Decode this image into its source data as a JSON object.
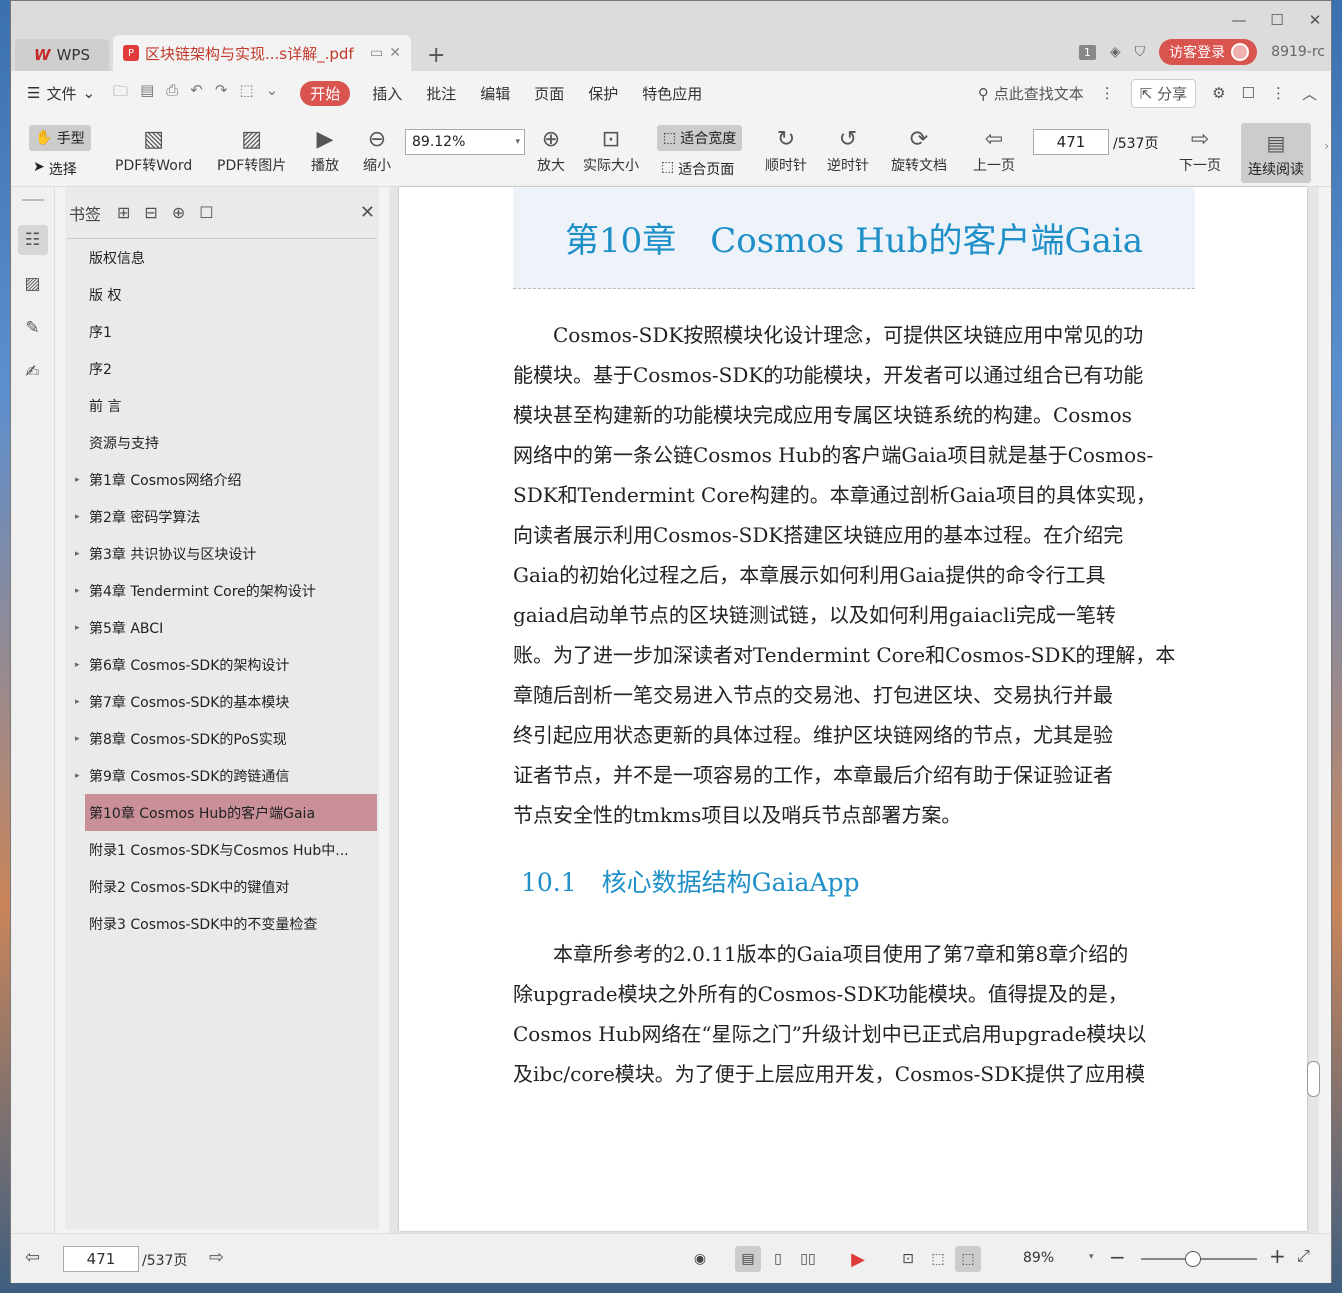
{
  "titlebar": {
    "wps_label": "WPS",
    "doc_tab_title": "区块链架构与实现...s详解_.pdf",
    "badge_num": "1",
    "login_label": "访客登录",
    "user_id": "8919-rc"
  },
  "menubar": {
    "file": "文件",
    "tabs": [
      "开始",
      "插入",
      "批注",
      "编辑",
      "页面",
      "保护",
      "特色应用"
    ],
    "search": "点此查找文本",
    "share": "分享"
  },
  "ribbon": {
    "hand": "手型",
    "select": "选择",
    "pdf_to_word": "PDF转Word",
    "pdf_to_image": "PDF转图片",
    "play": "播放",
    "zoom_out": "缩小",
    "zoom_value": "89.12%",
    "zoom_in": "放大",
    "actual_size": "实际大小",
    "fit_width": "适合宽度",
    "fit_page": "适合页面",
    "clockwise": "顺时针",
    "counterclockwise": "逆时针",
    "rotate_doc": "旋转文档",
    "prev_page": "上一页",
    "page_value": "471",
    "page_total": "/537页",
    "next_page": "下一页",
    "continuous": "连续阅读"
  },
  "bookmarks": {
    "title": "书签",
    "items": [
      {
        "label": "版权信息",
        "caret": false
      },
      {
        "label": "版 权",
        "caret": false
      },
      {
        "label": "序1",
        "caret": false
      },
      {
        "label": "序2",
        "caret": false
      },
      {
        "label": "前 言",
        "caret": false
      },
      {
        "label": "资源与支持",
        "caret": false
      },
      {
        "label": "第1章 Cosmos网络介绍",
        "caret": true
      },
      {
        "label": "第2章 密码学算法",
        "caret": true
      },
      {
        "label": "第3章 共识协议与区块设计",
        "caret": true
      },
      {
        "label": "第4章 Tendermint Core的架构设计",
        "caret": true
      },
      {
        "label": "第5章 ABCI",
        "caret": true
      },
      {
        "label": "第6章 Cosmos-SDK的架构设计",
        "caret": true
      },
      {
        "label": "第7章 Cosmos-SDK的基本模块",
        "caret": true
      },
      {
        "label": "第8章 Cosmos-SDK的PoS实现",
        "caret": true
      },
      {
        "label": "第9章 Cosmos-SDK的跨链通信",
        "caret": true
      },
      {
        "label": "第10章 Cosmos Hub的客户端Gaia",
        "caret": true,
        "selected": true
      },
      {
        "label": "附录1 Cosmos-SDK与Cosmos Hub中...",
        "caret": false
      },
      {
        "label": "附录2 Cosmos-SDK中的键值对",
        "caret": false
      },
      {
        "label": "附录3 Cosmos-SDK中的不变量检查",
        "caret": false
      }
    ]
  },
  "document": {
    "chapter_title": "第10章　Cosmos Hub的客户端Gaia",
    "para1": [
      "　　Cosmos-SDK按照模块化设计理念，可提供区块链应用中常见的功",
      "能模块。基于Cosmos-SDK的功能模块，开发者可以通过组合已有功能",
      "模块甚至构建新的功能模块完成应用专属区块链系统的构建。Cosmos",
      "网络中的第一条公链Cosmos Hub的客户端Gaia项目就是基于Cosmos-",
      "SDK和Tendermint Core构建的。本章通过剖析Gaia项目的具体实现，",
      "向读者展示利用Cosmos-SDK搭建区块链应用的基本过程。在介绍完",
      "Gaia的初始化过程之后，本章展示如何利用Gaia提供的命令行工具",
      "gaiad启动单节点的区块链测试链，以及如何利用gaiacli完成一笔转",
      "账。为了进一步加深读者对Tendermint Core和Cosmos-SDK的理解，本",
      "章随后剖析一笔交易进入节点的交易池、打包进区块、交易执行并最",
      "终引起应用状态更新的具体过程。维护区块链网络的节点，尤其是验",
      "证者节点，并不是一项容易的工作，本章最后介绍有助于保证验证者",
      "节点安全性的tmkms项目以及哨兵节点部署方案。"
    ],
    "section_title": "10.1　核心数据结构GaiaApp",
    "para2": [
      "　　本章所参考的2.0.11版本的Gaia项目使用了第7章和第8章介绍的",
      "除upgrade模块之外所有的Cosmos-SDK功能模块。值得提及的是，",
      "Cosmos Hub网络在“星际之门”升级计划中已正式启用upgrade模块以",
      "及ibc/core模块。为了便于上层应用开发，Cosmos-SDK提供了应用模"
    ]
  },
  "statusbar": {
    "page_value": "471",
    "page_total": "/537页",
    "zoom": "89%",
    "zoom_fraction": 0.45
  },
  "colors": {
    "accent": "#d9534f",
    "heading_blue": "#1f8fc8",
    "selected_bookmark": "#c9909a"
  }
}
